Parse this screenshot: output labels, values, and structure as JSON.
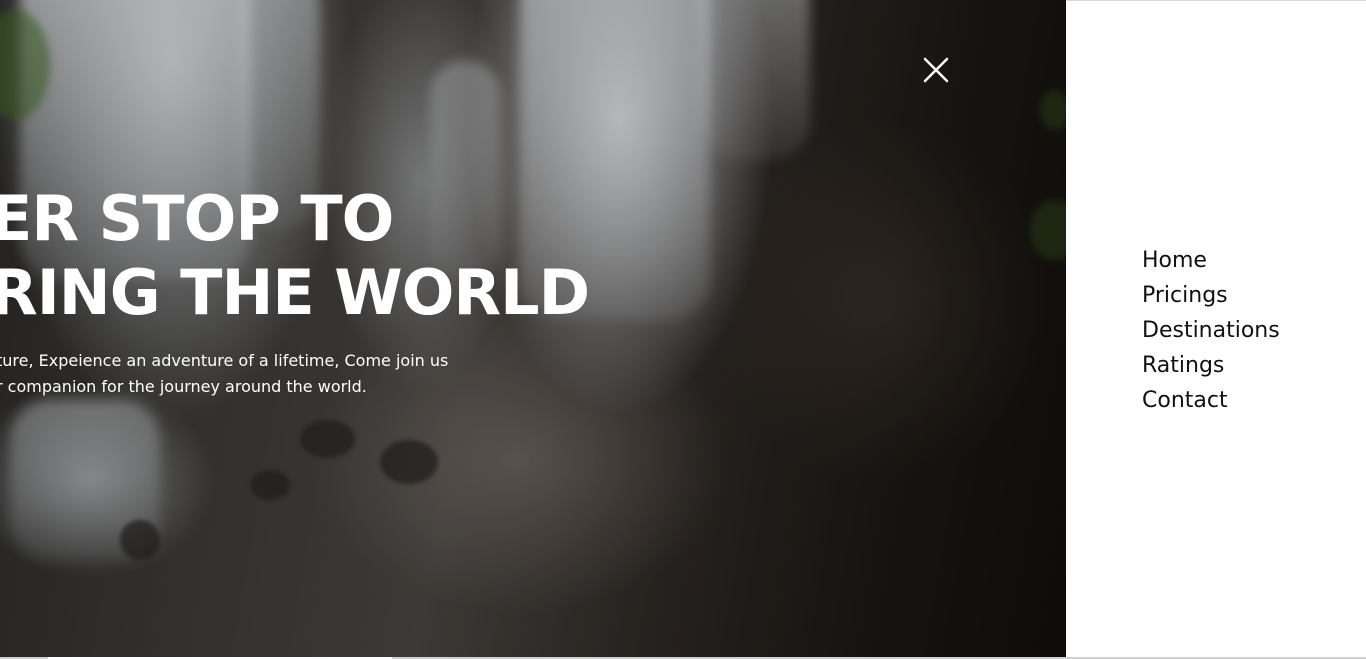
{
  "hero": {
    "headline_line1": "ER STOP TO",
    "headline_line2": "RING THE WORLD",
    "subtext_line1": "ture, Expeience an adventure of a lifetime, Come join us",
    "subtext_line2": "r companion for the journey around the world."
  },
  "close_button": {
    "icon": "close-icon",
    "color": "#ffffff"
  },
  "menu": {
    "items": [
      {
        "label": "Home"
      },
      {
        "label": "Pricings"
      },
      {
        "label": "Destinations"
      },
      {
        "label": "Ratings"
      },
      {
        "label": "Contact"
      }
    ],
    "text_color": "#111111",
    "background": "#ffffff"
  }
}
